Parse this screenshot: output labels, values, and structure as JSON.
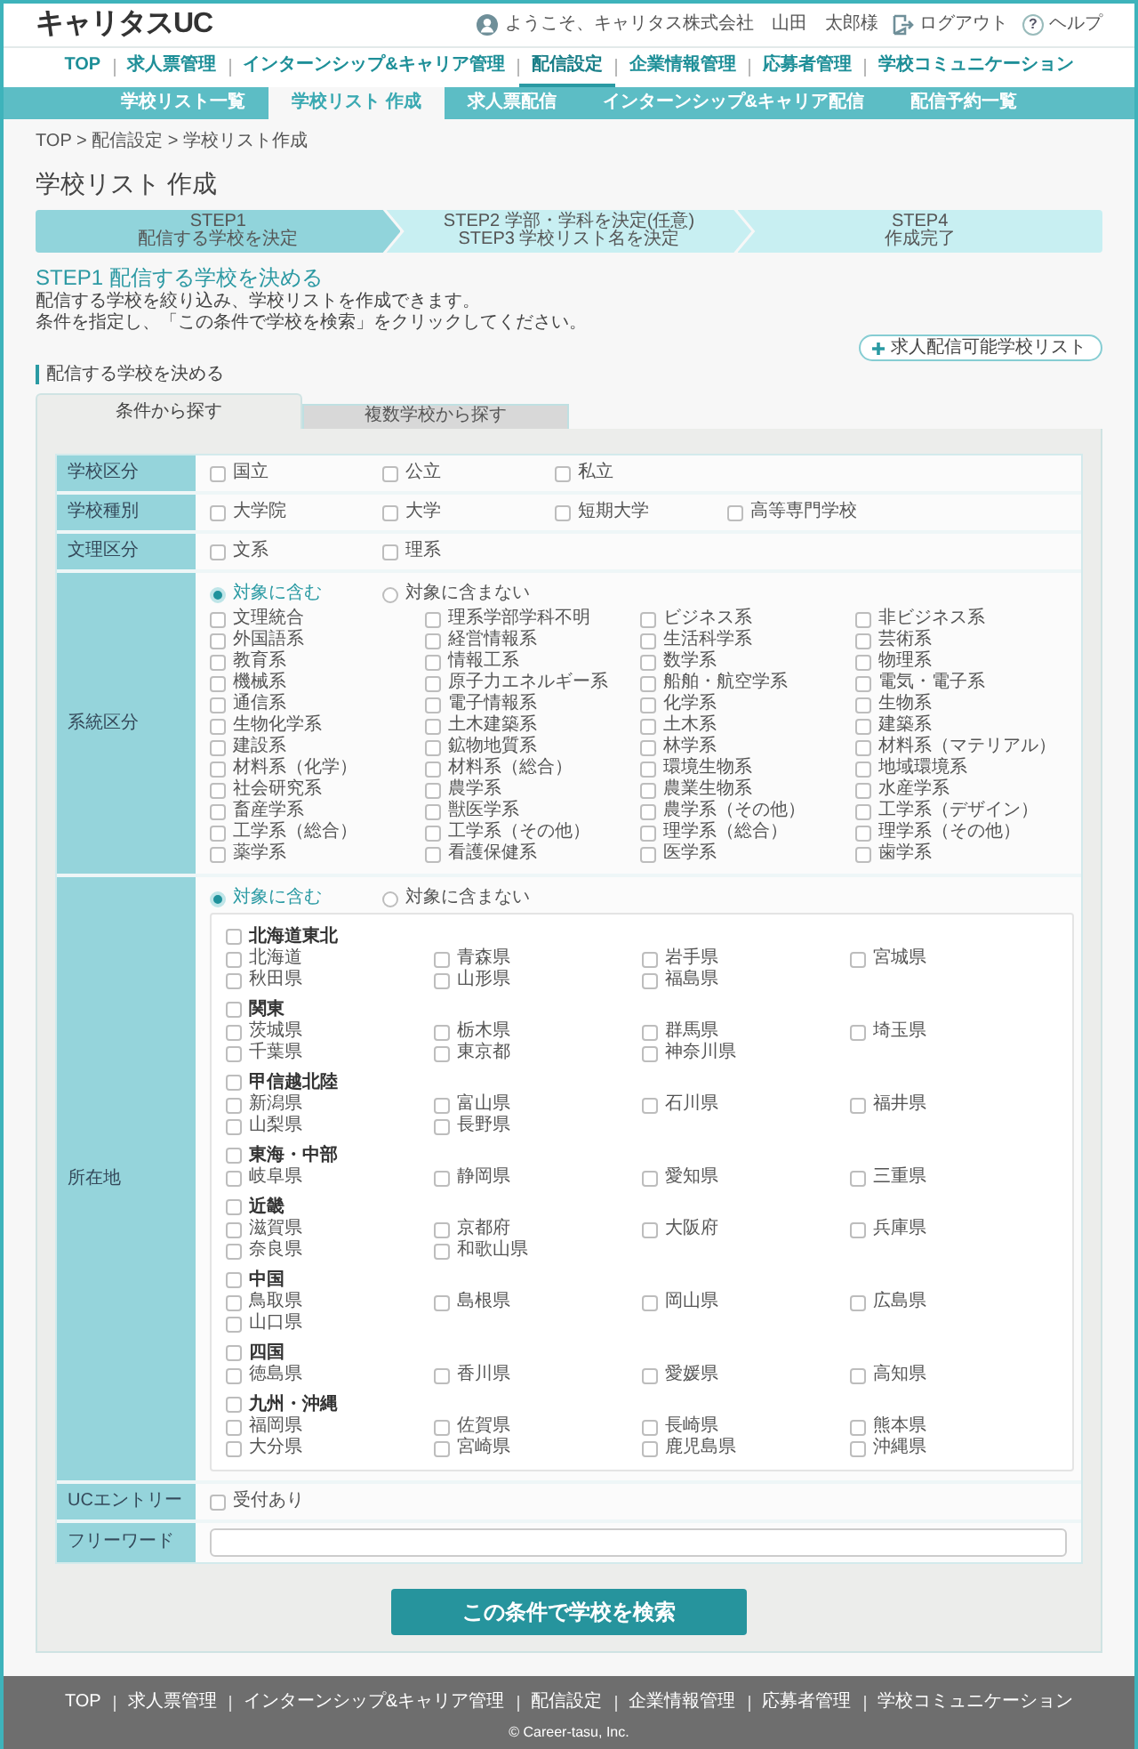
{
  "header": {
    "logo": "キャリタスUC",
    "welcome": "ようこそ、キャリタス株式会社　山田　太郎様",
    "logout": "ログアウト",
    "help": {
      "icon": "?",
      "label": "ヘルプ"
    }
  },
  "main_nav": [
    {
      "label": "TOP",
      "selected": false
    },
    {
      "label": "求人票管理",
      "selected": false
    },
    {
      "label": "インターンシップ&キャリア管理",
      "selected": false
    },
    {
      "label": "配信設定",
      "selected": true
    },
    {
      "label": "企業情報管理",
      "selected": false
    },
    {
      "label": "応募者管理",
      "selected": false
    },
    {
      "label": "学校コミュニケーション",
      "selected": false
    }
  ],
  "sub_nav": [
    {
      "label": "学校リスト一覧",
      "selected": false
    },
    {
      "label": "学校リスト 作成",
      "selected": true
    },
    {
      "label": "求人票配信",
      "selected": false
    },
    {
      "label": "インターンシップ&キャリア配信",
      "selected": false
    },
    {
      "label": "配信予約一覧",
      "selected": false
    }
  ],
  "breadcrumb": "TOP > 配信設定 > 学校リスト作成",
  "page_title": "学校リスト 作成",
  "steps": [
    {
      "lines": [
        "STEP1",
        "配信する学校を決定"
      ],
      "selected": true
    },
    {
      "lines": [
        "STEP2 学部・学科を決定(任意)",
        "STEP3 学校リスト名を決定"
      ],
      "selected": false
    },
    {
      "lines": [
        "STEP4",
        "作成完了"
      ],
      "selected": false
    }
  ],
  "step_heading": "STEP1 配信する学校を決める",
  "description": [
    "配信する学校を絞り込み、学校リストを作成できます。",
    "条件を指定し、「この条件で学校を検索」をクリックしてください。"
  ],
  "school_list_button": "求人配信可能学校リスト",
  "section_label": "配信する学校を決める",
  "tabs": [
    {
      "label": "条件から探す",
      "selected": true
    },
    {
      "label": "複数学校から探す",
      "selected": false
    }
  ],
  "form": {
    "rows": [
      {
        "kind": "checkboxes",
        "label": "学校区分",
        "options": [
          {
            "label": "国立",
            "checked": false
          },
          {
            "label": "公立",
            "checked": false
          },
          {
            "label": "私立",
            "checked": false
          }
        ]
      },
      {
        "kind": "checkboxes",
        "label": "学校種別",
        "options": [
          {
            "label": "大学院",
            "checked": false
          },
          {
            "label": "大学",
            "checked": false
          },
          {
            "label": "短期大学",
            "checked": false
          },
          {
            "label": "高等専門学校",
            "checked": false
          }
        ]
      },
      {
        "kind": "checkboxes",
        "label": "文理区分",
        "options": [
          {
            "label": "文系",
            "checked": false
          },
          {
            "label": "理系",
            "checked": false
          }
        ]
      },
      {
        "kind": "faculty",
        "label": "系統区分",
        "scope": [
          {
            "label": "対象に含む",
            "selected": true
          },
          {
            "label": "対象に含まない",
            "selected": false
          }
        ],
        "options": [
          {
            "label": "文理統合",
            "checked": false
          },
          {
            "label": "理系学部学科不明",
            "checked": false
          },
          {
            "label": "ビジネス系",
            "checked": false
          },
          {
            "label": "非ビジネス系",
            "checked": false
          },
          {
            "label": "外国語系",
            "checked": false
          },
          {
            "label": "経営情報系",
            "checked": false
          },
          {
            "label": "生活科学系",
            "checked": false
          },
          {
            "label": "芸術系",
            "checked": false
          },
          {
            "label": "教育系",
            "checked": false
          },
          {
            "label": "情報工系",
            "checked": false
          },
          {
            "label": "数学系",
            "checked": false
          },
          {
            "label": "物理系",
            "checked": false
          },
          {
            "label": "機械系",
            "checked": false
          },
          {
            "label": "原子力エネルギー系",
            "checked": false
          },
          {
            "label": "船舶・航空学系",
            "checked": false
          },
          {
            "label": "電気・電子系",
            "checked": false
          },
          {
            "label": "通信系",
            "checked": false
          },
          {
            "label": "電子情報系",
            "checked": false
          },
          {
            "label": "化学系",
            "checked": false
          },
          {
            "label": "生物系",
            "checked": false
          },
          {
            "label": "生物化学系",
            "checked": false
          },
          {
            "label": "土木建築系",
            "checked": false
          },
          {
            "label": "土木系",
            "checked": false
          },
          {
            "label": "建築系",
            "checked": false
          },
          {
            "label": "建設系",
            "checked": false
          },
          {
            "label": "鉱物地質系",
            "checked": false
          },
          {
            "label": "林学系",
            "checked": false
          },
          {
            "label": "材料系（マテリアル）",
            "checked": false
          },
          {
            "label": "材料系（化学）",
            "checked": false
          },
          {
            "label": "材料系（総合）",
            "checked": false
          },
          {
            "label": "環境生物系",
            "checked": false
          },
          {
            "label": "地域環境系",
            "checked": false
          },
          {
            "label": "社会研究系",
            "checked": false
          },
          {
            "label": "農学系",
            "checked": false
          },
          {
            "label": "農業生物系",
            "checked": false
          },
          {
            "label": "水産学系",
            "checked": false
          },
          {
            "label": "畜産学系",
            "checked": false
          },
          {
            "label": "獣医学系",
            "checked": false
          },
          {
            "label": "農学系（その他）",
            "checked": false
          },
          {
            "label": "工学系（デザイン）",
            "checked": false
          },
          {
            "label": "工学系（総合）",
            "checked": false
          },
          {
            "label": "工学系（その他）",
            "checked": false
          },
          {
            "label": "理学系（総合）",
            "checked": false
          },
          {
            "label": "理学系（その他）",
            "checked": false
          },
          {
            "label": "薬学系",
            "checked": false
          },
          {
            "label": "看護保健系",
            "checked": false
          },
          {
            "label": "医学系",
            "checked": false
          },
          {
            "label": "歯学系",
            "checked": false
          }
        ]
      },
      {
        "kind": "regions",
        "label": "所在地",
        "scope": [
          {
            "label": "対象に含む",
            "selected": true
          },
          {
            "label": "対象に含まない",
            "selected": false
          }
        ],
        "regions": [
          {
            "label": "北海道東北",
            "checked": false,
            "prefectures": [
              {
                "label": "北海道",
                "checked": false
              },
              {
                "label": "青森県",
                "checked": false
              },
              {
                "label": "岩手県",
                "checked": false
              },
              {
                "label": "宮城県",
                "checked": false
              },
              {
                "label": "秋田県",
                "checked": false
              },
              {
                "label": "山形県",
                "checked": false
              },
              {
                "label": "福島県",
                "checked": false
              }
            ]
          },
          {
            "label": "関東",
            "checked": false,
            "prefectures": [
              {
                "label": "茨城県",
                "checked": false
              },
              {
                "label": "栃木県",
                "checked": false
              },
              {
                "label": "群馬県",
                "checked": false
              },
              {
                "label": "埼玉県",
                "checked": false
              },
              {
                "label": "千葉県",
                "checked": false
              },
              {
                "label": "東京都",
                "checked": false
              },
              {
                "label": "神奈川県",
                "checked": false
              }
            ]
          },
          {
            "label": "甲信越北陸",
            "checked": false,
            "prefectures": [
              {
                "label": "新潟県",
                "checked": false
              },
              {
                "label": "富山県",
                "checked": false
              },
              {
                "label": "石川県",
                "checked": false
              },
              {
                "label": "福井県",
                "checked": false
              },
              {
                "label": "山梨県",
                "checked": false
              },
              {
                "label": "長野県",
                "checked": false
              }
            ]
          },
          {
            "label": "東海・中部",
            "checked": false,
            "prefectures": [
              {
                "label": "岐阜県",
                "checked": false
              },
              {
                "label": "静岡県",
                "checked": false
              },
              {
                "label": "愛知県",
                "checked": false
              },
              {
                "label": "三重県",
                "checked": false
              }
            ]
          },
          {
            "label": "近畿",
            "checked": false,
            "prefectures": [
              {
                "label": "滋賀県",
                "checked": false
              },
              {
                "label": "京都府",
                "checked": false
              },
              {
                "label": "大阪府",
                "checked": false
              },
              {
                "label": "兵庫県",
                "checked": false
              },
              {
                "label": "奈良県",
                "checked": false
              },
              {
                "label": "和歌山県",
                "checked": false
              }
            ]
          },
          {
            "label": "中国",
            "checked": false,
            "prefectures": [
              {
                "label": "鳥取県",
                "checked": false
              },
              {
                "label": "島根県",
                "checked": false
              },
              {
                "label": "岡山県",
                "checked": false
              },
              {
                "label": "広島県",
                "checked": false
              },
              {
                "label": "山口県",
                "checked": false
              }
            ]
          },
          {
            "label": "四国",
            "checked": false,
            "prefectures": [
              {
                "label": "徳島県",
                "checked": false
              },
              {
                "label": "香川県",
                "checked": false
              },
              {
                "label": "愛媛県",
                "checked": false
              },
              {
                "label": "高知県",
                "checked": false
              }
            ]
          },
          {
            "label": "九州・沖縄",
            "checked": false,
            "prefectures": [
              {
                "label": "福岡県",
                "checked": false
              },
              {
                "label": "佐賀県",
                "checked": false
              },
              {
                "label": "長崎県",
                "checked": false
              },
              {
                "label": "熊本県",
                "checked": false
              },
              {
                "label": "大分県",
                "checked": false
              },
              {
                "label": "宮崎県",
                "checked": false
              },
              {
                "label": "鹿児島県",
                "checked": false
              },
              {
                "label": "沖縄県",
                "checked": false
              }
            ]
          }
        ]
      },
      {
        "kind": "checkboxes",
        "label": "UCエントリー",
        "options": [
          {
            "label": "受付あり",
            "checked": false
          }
        ]
      },
      {
        "kind": "text",
        "label": "フリーワード"
      }
    ]
  },
  "search_button": "この条件で学校を検索",
  "footer": {
    "links": [
      "TOP",
      "求人票管理",
      "インターンシップ&キャリア管理",
      "配信設定",
      "企業情報管理",
      "応募者管理",
      "学校コミュニケーション"
    ],
    "copyright": "© Career-tasu, Inc."
  }
}
